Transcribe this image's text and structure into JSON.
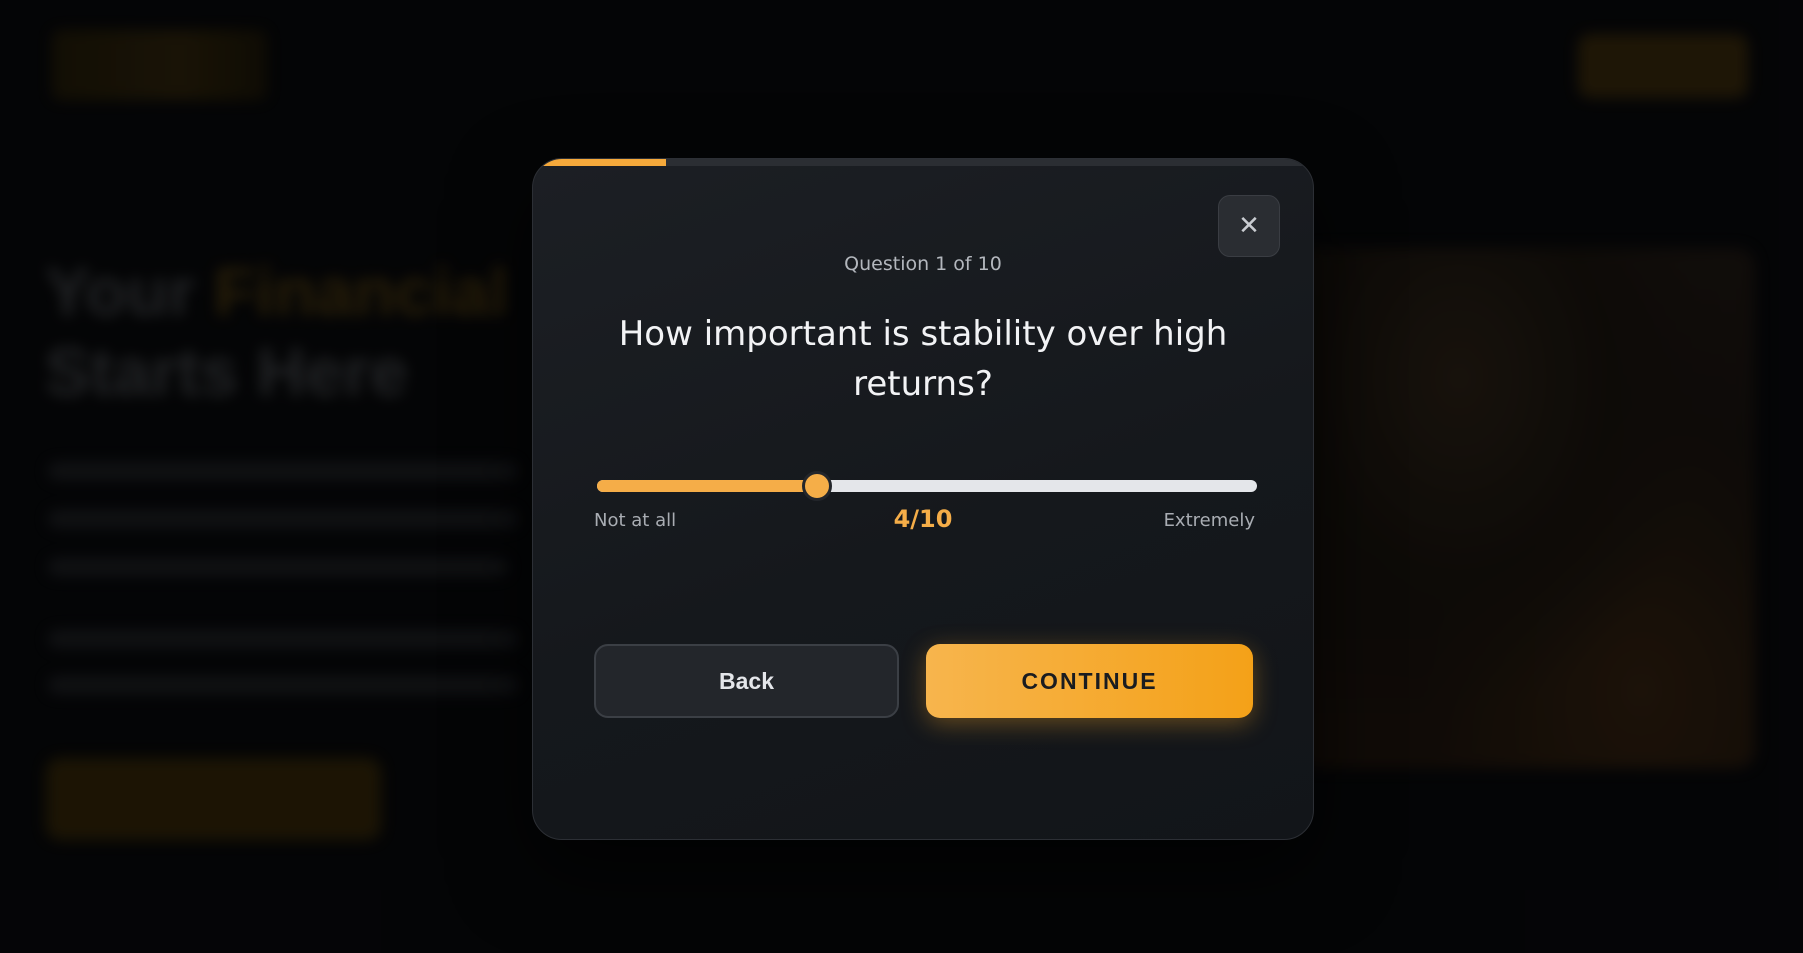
{
  "background": {
    "hero_title_part1": "Your",
    "hero_title_accent": "Financial",
    "hero_title_part2": "Starts Here"
  },
  "modal": {
    "progress": 0.17,
    "close_icon": "close-icon",
    "counter": "Question 1 of 10",
    "question": "How important is stability over high returns?",
    "slider": {
      "value": 4,
      "min": 1,
      "max": 10,
      "min_label": "Not at all",
      "max_label": "Extremely",
      "readout": "4/10"
    },
    "back_label": "Back",
    "continue_label": "CONTINUE"
  },
  "colors": {
    "accent": "#f5ad48",
    "modal_bg": "#181b20",
    "track": "#e4e6ea"
  }
}
